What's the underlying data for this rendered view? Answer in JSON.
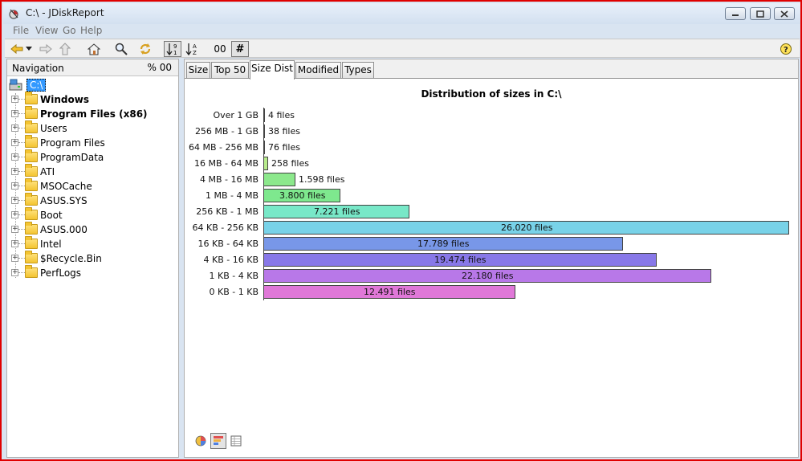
{
  "window": {
    "title": "C:\\ - JDiskReport",
    "buttons": [
      "minimize",
      "maximize",
      "close"
    ]
  },
  "menu": [
    "File",
    "View",
    "Go",
    "Help"
  ],
  "toolbar": {
    "icons": [
      "back-icon",
      "back-dropdown-icon",
      "forward-icon",
      "up-icon",
      "home-icon",
      "search-icon",
      "refresh-icon",
      "sort-size-icon",
      "sort-name-icon"
    ],
    "percent_label": "00",
    "hash_label": "#",
    "help_icon": "help-icon"
  },
  "navigation": {
    "header": "Navigation",
    "percent_header": "% 00",
    "root": "C:\\",
    "items": [
      {
        "label": "Windows",
        "bold": true
      },
      {
        "label": "Program Files (x86)",
        "bold": true
      },
      {
        "label": "Users",
        "bold": false
      },
      {
        "label": "Program Files",
        "bold": false
      },
      {
        "label": "ProgramData",
        "bold": false
      },
      {
        "label": "ATI",
        "bold": false
      },
      {
        "label": "MSOCache",
        "bold": false
      },
      {
        "label": "ASUS.SYS",
        "bold": false
      },
      {
        "label": "Boot",
        "bold": false
      },
      {
        "label": "ASUS.000",
        "bold": false
      },
      {
        "label": "Intel",
        "bold": false
      },
      {
        "label": "$Recycle.Bin",
        "bold": false
      },
      {
        "label": "PerfLogs",
        "bold": false
      }
    ]
  },
  "tabs": [
    {
      "label": "Size",
      "active": false
    },
    {
      "label": "Top 50",
      "active": false
    },
    {
      "label": "Size Dist",
      "active": true
    },
    {
      "label": "Modified",
      "active": false
    },
    {
      "label": "Types",
      "active": false
    }
  ],
  "chart_data": {
    "type": "bar",
    "orientation": "horizontal",
    "title": "Distribution of sizes in C:\\",
    "xlabel": "",
    "ylabel": "",
    "categories": [
      "Over 1 GB",
      "256 MB - 1 GB",
      "64 MB - 256 MB",
      "16 MB - 64 MB",
      "4 MB - 16 MB",
      "1 MB - 4 MB",
      "256 KB - 1 MB",
      "64 KB - 256 KB",
      "16 KB - 64 KB",
      "4 KB - 16 KB",
      "1 KB - 4 KB",
      "0 KB - 1 KB"
    ],
    "values": [
      4,
      38,
      76,
      258,
      1598,
      3800,
      7221,
      26020,
      17789,
      19474,
      22180,
      12491
    ],
    "value_labels": [
      "4 files",
      "38 files",
      "76 files",
      "258 files",
      "1.598 files",
      "3.800 files",
      "7.221 files",
      "26.020 files",
      "17.789 files",
      "19.474 files",
      "22.180 files",
      "12.491 files"
    ],
    "colors": [
      "#c8c8a0",
      "#c8c8a0",
      "#c8e08c",
      "#b8ec8c",
      "#8ce88c",
      "#7ee88e",
      "#78e8c8",
      "#78d2e8",
      "#7897e8",
      "#8878e8",
      "#b878e8",
      "#e078d8"
    ],
    "grid": false,
    "legend": "none"
  },
  "view_buttons": [
    "pie-chart-icon",
    "bar-chart-icon",
    "table-view-icon"
  ]
}
